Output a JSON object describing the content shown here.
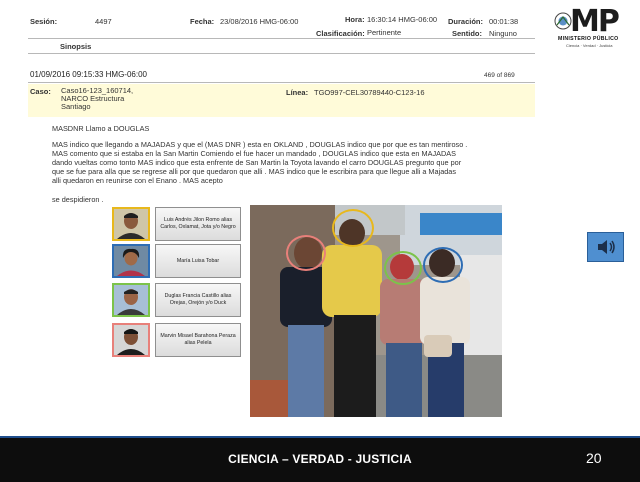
{
  "header": {
    "sesion_label": "Sesión:",
    "sesion_value": "4497",
    "fecha_label": "Fecha:",
    "fecha_value": "23/08/2016 HMG-06:00",
    "hora_label": "Hora:",
    "hora_value": "16:30:14 HMG-06:00",
    "duracion_label": "Duración:",
    "duracion_value": "00:01:38",
    "clasificacion_label": "Clasificación:",
    "clasificacion_value": "Pertinente",
    "sentido_label": "Sentido:",
    "sentido_value": "Ninguno",
    "sinopsis_label": "Sinopsis"
  },
  "record": {
    "datetime": "01/09/2016 09:15:33 HMG-06:00",
    "page_count": "469 of 869",
    "caso_label": "Caso:",
    "caso_lines": [
      "Caso16-123_160714,",
      "NARCO Estructura",
      "Santiago"
    ],
    "linea_label": "Línea:",
    "linea_value": "TGO997-CEL30789440-C123-16"
  },
  "transcript": {
    "line1": "MASDNR  Llamo a  DOUGLAS",
    "paragraph": [
      "MAS  indico que llegando a  MAJADAS   y que el (MAS DNR )  esta en OKLAND  ,  DOUGLAS  indico que por que es tan mentiroso .",
      "MAS  comento que si estaba en la San Martin Comiendo   el fue hacer un mandado ,   DOUGLAS  indico que  esta  en MAJADAS",
      "dando vueltas como tonto   MAS  indico que esta enfrente de San Martin  la Toyota  lavando el carro  DOUGLAS  pregunto que  por",
      "que se fue para alla    que se regrese alli por que quedaron que alli . MAS  indico que le  escribira   para que llegue alli a Majadas",
      "alli quedaron en reunirse con el Enano . MAS  acepto"
    ],
    "closing": "se despidieron ."
  },
  "suspects": [
    {
      "name": "Luis Andrés Jilon Romo alias Carlos, Oxlamat, Jota y/o Negro",
      "color": "#e8b81c"
    },
    {
      "name": "María Luisa Tobar",
      "color": "#2e6db4"
    },
    {
      "name": "Duglas Francia Castillo alias Orejas, Orejón y/o Duck",
      "color": "#7cc34a"
    },
    {
      "name": "Marvin Misael Barahona Peraza alias Pelela",
      "color": "#e8807a"
    }
  ],
  "logo": {
    "title": "MP",
    "subtitle": "MINISTERIO PÚBLICO",
    "motto": "Ciencia · Verdad · Justicia"
  },
  "footer": {
    "text": "CIENCIA – VERDAD - JUSTICIA",
    "page_number": "20"
  },
  "icons": {
    "audio": "speaker-icon"
  }
}
